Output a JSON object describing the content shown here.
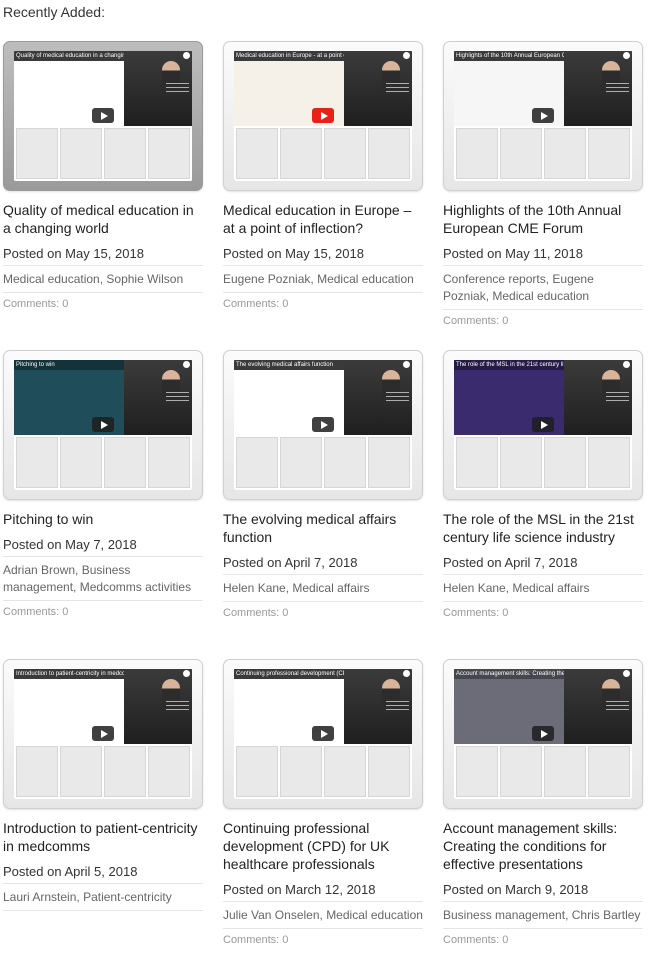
{
  "section_title": "Recently Added:",
  "cards": [
    {
      "slide_text": "Quality of medical education in a changing world",
      "title": "Quality of medical education in a changing world",
      "date": "Posted on May 15, 2018",
      "tags": [
        "Medical education",
        "Sophie Wilson"
      ],
      "comments": "Comments: 0",
      "play_style": "dark",
      "slide_color": "#ffffff"
    },
    {
      "slide_text": "Medical education in Europe - at a point of inflection?",
      "title": "Medical education in Europe – at a point of inflection?",
      "date": "Posted on May 15, 2018",
      "tags": [
        "Eugene Pozniak",
        "Medical education"
      ],
      "comments": "Comments: 0",
      "play_style": "red",
      "slide_color": "#f5f1e8"
    },
    {
      "slide_text": "Highlights of the 10th Annual European CME Forum",
      "title": "Highlights of the 10th Annual European CME Forum",
      "date": "Posted on May 11, 2018",
      "tags": [
        "Conference reports",
        "Eugene Pozniak",
        "Medical education"
      ],
      "comments": "Comments: 0",
      "play_style": "dark",
      "slide_color": "#f6f6f6"
    },
    {
      "slide_text": "Pitching to win",
      "title": "Pitching to win",
      "date": "Posted on May 7, 2018",
      "tags": [
        "Adrian Brown",
        "Business management",
        "Medcomms activities"
      ],
      "comments": "Comments: 0",
      "play_style": "dark",
      "slide_color": "#1f4e5a"
    },
    {
      "slide_text": "The evolving medical affairs function",
      "title": "The evolving medical affairs function",
      "date": "Posted on April 7, 2018",
      "tags": [
        "Helen Kane",
        "Medical affairs"
      ],
      "comments": "Comments: 0",
      "play_style": "dark",
      "slide_color": "#ffffff"
    },
    {
      "slide_text": "The role of the MSL in the 21st century life science industry",
      "title": "The role of the MSL in the 21st century life science industry",
      "date": "Posted on April 7, 2018",
      "tags": [
        "Helen Kane",
        "Medical affairs"
      ],
      "comments": "Comments: 0",
      "play_style": "dark",
      "slide_color": "#3a2a6e"
    },
    {
      "slide_text": "Introduction to patient-centricity in medcomms",
      "title": "Introduction to patient-centricity in medcomms",
      "date": "Posted on April 5, 2018",
      "tags": [
        "Lauri Arnstein",
        "Patient-centricity"
      ],
      "comments": "",
      "play_style": "dark",
      "slide_color": "#ffffff"
    },
    {
      "slide_text": "Continuing professional development (CPD) for UK healthcare pro...",
      "title": "Continuing professional development (CPD) for UK healthcare professionals",
      "date": "Posted on March 12, 2018",
      "tags": [
        "Julie Van Onselen",
        "Medical education"
      ],
      "comments": "Comments: 0",
      "play_style": "dark",
      "slide_color": "#ffffff"
    },
    {
      "slide_text": "Account management skills: Creating the conditions for effective ...",
      "title": "Account management skills: Creating the conditions for effective presentations",
      "date": "Posted on March 9, 2018",
      "tags": [
        "Business management",
        "Chris Bartley"
      ],
      "comments": "Comments: 0",
      "play_style": "dark",
      "slide_color": "#6c6c78"
    }
  ],
  "colors": {
    "text": "#222222",
    "meta": "#666666",
    "comments": "#999999",
    "divider": "#e5e5e5"
  }
}
